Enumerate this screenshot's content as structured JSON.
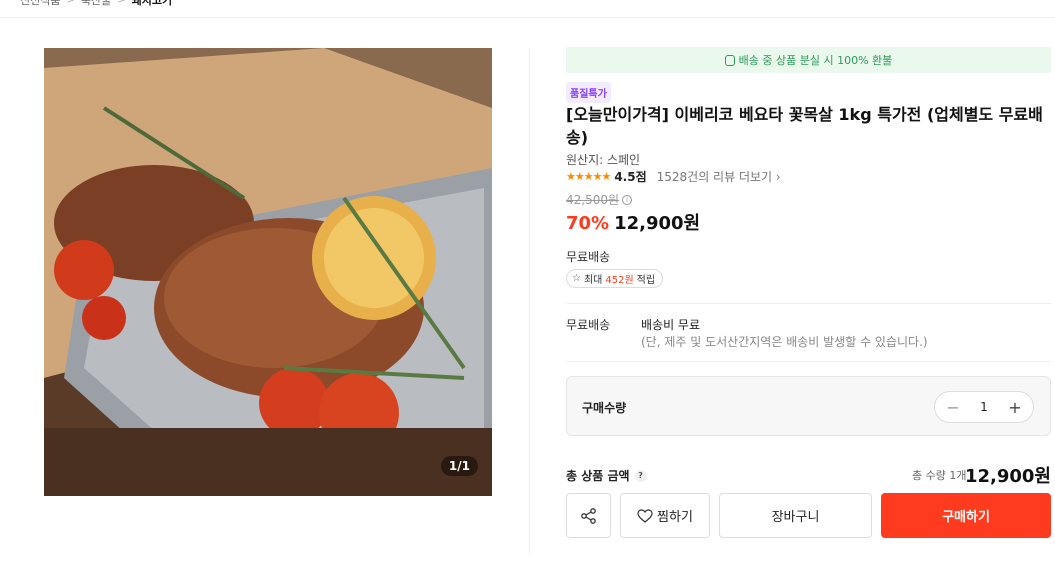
{
  "breadcrumb": {
    "items": [
      "신선식품",
      "축산물"
    ],
    "current": "돼지고기"
  },
  "gallery": {
    "counter": "1/1"
  },
  "product": {
    "notice": "배송 중 상품 분실 시 100% 환불",
    "badge": "품질특가",
    "title": "[오늘만이가격] 이베리코 베요타 꽃목살 1kg 특가전 (업체별도 무료배송)",
    "origin": "원산지: 스페인",
    "rating": "4.5점",
    "reviews": "1528건의 리뷰 더보기",
    "original_price": "42,500원",
    "discount": "70%",
    "price": "12,900원",
    "free_shipping_label": "무료배송",
    "points": {
      "prefix": "최대",
      "amount": "452원",
      "suffix": "적립"
    }
  },
  "shipping": {
    "label": "무료배송",
    "value": "배송비 무료",
    "note": "(단, 제주 및 도서산간지역은 배송비 발생할 수 있습니다.)"
  },
  "quantity": {
    "label": "구매수량",
    "value": "1"
  },
  "total": {
    "label": "총 상품 금액",
    "qty_text": "총 수량 1개",
    "price": "12,900원"
  },
  "actions": {
    "wish": "찜하기",
    "cart": "장바구니",
    "buy": "구매하기"
  },
  "colors": {
    "accent": "#ff3b1f",
    "notice_green": "#2e9b5a",
    "badge_purple": "#8a3ffc",
    "star": "#ff8a00"
  }
}
